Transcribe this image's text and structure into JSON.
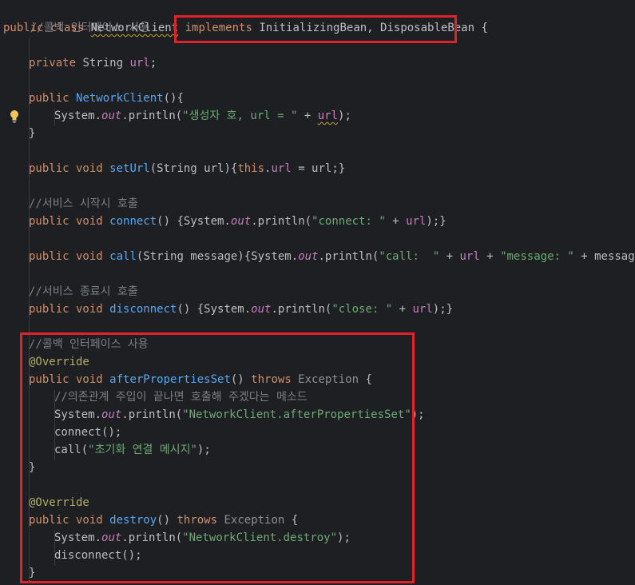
{
  "code": {
    "l1_comment": "//콜백 인터페이스 사용",
    "l2_public_class": "public class ",
    "l2_classname": "NetworkClient",
    "l2_implements": "implements",
    "l2_interfaces": " InitializingBean, DisposableBean",
    "l2_brace": " {",
    "l3_private": "private ",
    "l3_type": "String ",
    "l3_field": "url",
    "l3_semi": ";",
    "l4_public": "public ",
    "l4_ctor": "NetworkClient",
    "l4_rest": "(){",
    "l5_system": "System.",
    "l5_out": "out",
    "l5_println": ".println(",
    "l5_str": "\"생성자 호, url = \"",
    "l5_plus": " + ",
    "l5_url": "url",
    "l5_end": ");",
    "close_brace": "}",
    "l6_public_void": "public void ",
    "l6_name": "setUrl",
    "l6_params": "(String url){",
    "l6_this": "this",
    "l6_dot": ".",
    "l6_url": "url",
    "l6_end": " = url;}",
    "l7_comment": "//서비스 시작시 호출",
    "l8_public_void": "public void ",
    "l8_name": "connect",
    "l8_mid": "() {System.",
    "l8_out": "out",
    "l8_println": ".println(",
    "l8_str": "\"connect: \"",
    "l8_plus": " + ",
    "l8_url": "url",
    "l8_end": ");}",
    "l9_public_void": "public void ",
    "l9_name": "call",
    "l9_mid": "(String message){System.",
    "l9_out": "out",
    "l9_println": ".println(",
    "l9_str1": "\"call:  \"",
    "l9_plus1": " + ",
    "l9_url": "url",
    "l9_plus2": " + ",
    "l9_str2": "\"message: \"",
    "l9_end": " + message);}",
    "l10_comment": "//서비스 종료시 호출",
    "l11_public_void": "public void ",
    "l11_name": "disconnect",
    "l11_mid": "() {System.",
    "l11_out": "out",
    "l11_println": ".println(",
    "l11_str": "\"close: \"",
    "l11_plus": " + ",
    "l11_url": "url",
    "l11_end": ");}",
    "l12_comment": "//콜백 인터페이스 사용",
    "override": "@Override",
    "l14_public_void": "public void ",
    "l14_name": "afterPropertiesSet",
    "l14_paren": "() ",
    "throws": "throws",
    "exception": " Exception",
    "open_brace": " {",
    "l15_comment": "//의존관계 주입이 끝나면 호출해 주겠다는 메소드",
    "l16_system": "System.",
    "l16_out": "out",
    "l16_println": ".println(",
    "l16_str": "\"NetworkClient.afterPropertiesSet\"",
    "l16_end": ");",
    "l17_call": "connect();",
    "l18_call": "call(",
    "l18_str": "\"초기화 연결 메시지\"",
    "l18_end": ");",
    "l21_public_void": "public void ",
    "l21_name": "destroy",
    "l21_paren": "() ",
    "l22_system": "System.",
    "l22_out": "out",
    "l22_println": ".println(",
    "l22_str": "\"NetworkClient.destroy\"",
    "l22_end": ");",
    "l23_call": "disconnect();"
  },
  "colors": {
    "background": "#1e1f22",
    "keyword": "#cf8e6d",
    "function": "#56a8f5",
    "field": "#c77dbb",
    "string": "#6aab73",
    "comment": "#7a7e85",
    "annotation": "#b3ae60",
    "highlight_box": "#e0222b"
  },
  "icons": {
    "gutter": "lightbulb-icon"
  }
}
